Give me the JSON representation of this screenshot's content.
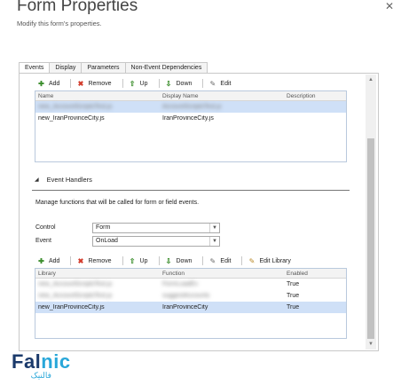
{
  "header": {
    "title": "Form Properties",
    "subtitle": "Modify this form's properties.",
    "close_glyph": "✕"
  },
  "tabs": [
    {
      "label": "Events",
      "active": true
    },
    {
      "label": "Display",
      "active": false
    },
    {
      "label": "Parameters",
      "active": false
    },
    {
      "label": "Non-Event Dependencies",
      "active": false
    }
  ],
  "libraries": {
    "toolbar": {
      "add": "Add",
      "remove": "Remove",
      "up": "Up",
      "down": "Down",
      "edit": "Edit"
    },
    "columns": [
      "Name",
      "Display Name",
      "Description"
    ],
    "rows": [
      {
        "name": "new_AccountScriptsTest.js",
        "display_name": "AccountScriptsTest.js",
        "description": "",
        "selected": true,
        "obscured": true
      },
      {
        "name": "new_IranProvinceCity.js",
        "display_name": "IranProvinceCity.js",
        "description": "",
        "selected": false,
        "obscured": false
      }
    ]
  },
  "event_handlers": {
    "section_title": "Event Handlers",
    "description": "Manage functions that will be called for form or field events.",
    "control_label": "Control",
    "control_value": "Form",
    "event_label": "Event",
    "event_value": "OnLoad",
    "toolbar": {
      "add": "Add",
      "remove": "Remove",
      "up": "Up",
      "down": "Down",
      "edit": "Edit",
      "edit_library": "Edit Library"
    },
    "columns": [
      "Library",
      "Function",
      "Enabled"
    ],
    "rows": [
      {
        "library": "new_AccountScriptsTest.js",
        "function": "FormLoadEv",
        "enabled": "True",
        "selected": false,
        "obscured": true
      },
      {
        "library": "new_AccountScriptsTest.js",
        "function": "suggestAccounts",
        "enabled": "True",
        "selected": false,
        "obscured": true
      },
      {
        "library": "new_IranProvinceCity.js",
        "function": "IranProvinceCity",
        "enabled": "True",
        "selected": true,
        "obscured": false
      }
    ]
  },
  "watermark": {
    "brand_a": "Fal",
    "brand_b": "nic",
    "sub": "فالنیک"
  },
  "colors": {
    "selection": "#cfe0f7",
    "brand_dark": "#1b3a6b",
    "brand_light": "#29a7d9"
  }
}
